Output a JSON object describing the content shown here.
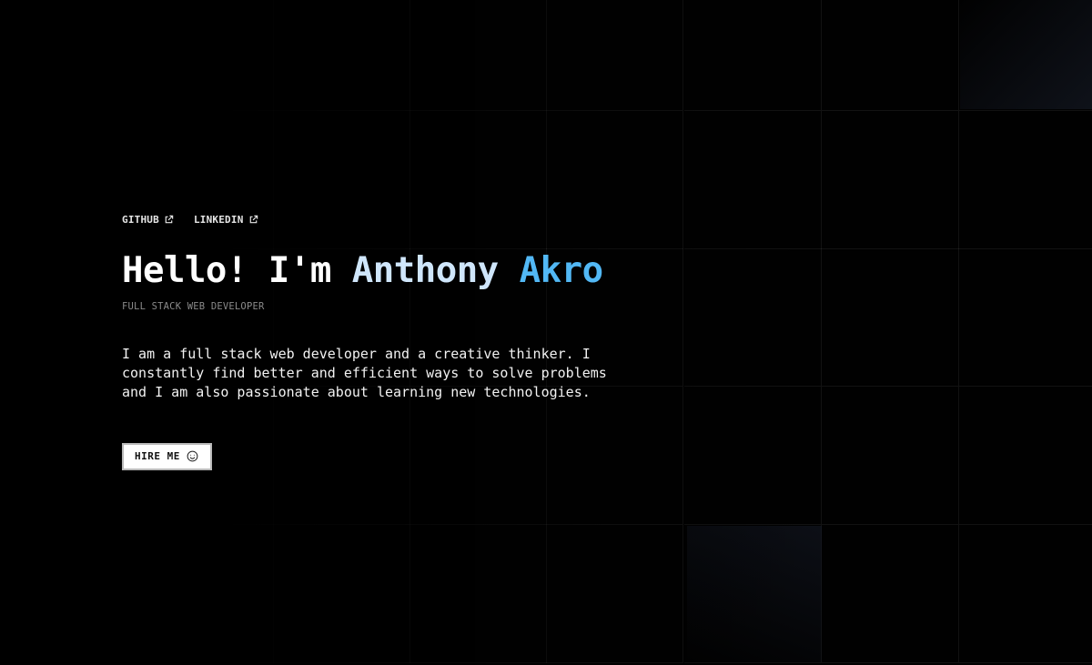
{
  "social": {
    "links": [
      {
        "label": "GITHUB",
        "icon": "external-link-icon"
      },
      {
        "label": "LINKEDIN",
        "icon": "external-link-icon"
      }
    ]
  },
  "hero": {
    "greeting": "Hello! I'm",
    "first_name": "Anthony",
    "last_name": "Akro",
    "subtitle": "FULL STACK WEB DEVELOPER",
    "bio": "I am a full stack web developer and a creative thinker. I constantly find better and efficient ways to solve problems and I am also passionate about learning new technologies.",
    "cta_label": "HIRE ME",
    "cta_icon": "smile-icon"
  },
  "colors": {
    "background": "#010101",
    "grid_line": "#1a1a1a",
    "first_name": "#cfe6fb",
    "last_name": "#52b8f5",
    "subtitle": "#8a8a8a",
    "button_bg": "#ffffff"
  }
}
